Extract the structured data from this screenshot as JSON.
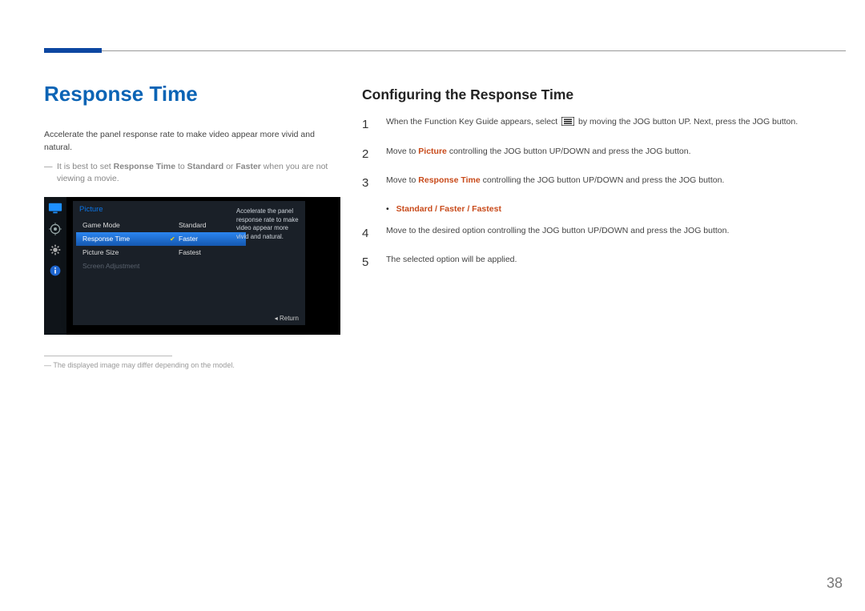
{
  "pageNumber": "38",
  "left": {
    "heading": "Response Time",
    "intro": "Accelerate the panel response rate to make video appear more vivid and natural.",
    "note_prefix": "It is best to set ",
    "note_b1": "Response Time",
    "note_mid1": " to ",
    "note_b2": "Standard",
    "note_mid2": " or ",
    "note_b3": "Faster",
    "note_suffix": " when you are not viewing a movie.",
    "footnote": "The displayed image may differ depending on the model."
  },
  "osd": {
    "title": "Picture",
    "menu": [
      "Game Mode",
      "Response Time",
      "Picture Size",
      "Screen Adjustment"
    ],
    "sub": [
      "Standard",
      "Faster",
      "Fastest"
    ],
    "help": "Accelerate the panel response rate to make video appear more vivid and natural.",
    "return": "Return"
  },
  "right": {
    "heading": "Configuring the Response Time",
    "steps": {
      "s1a": "When the Function Key Guide appears, select ",
      "s1b": " by moving the JOG button UP. Next, press the JOG button.",
      "s2a": "Move to ",
      "s2hl": "Picture",
      "s2b": " controlling the JOG button UP/DOWN and press the JOG button.",
      "s3a": "Move to ",
      "s3hl": "Response Time",
      "s3b": " controlling the JOG button UP/DOWN and press the JOG button.",
      "options": [
        "Standard",
        "Faster",
        "Fastest"
      ],
      "s4": "Move to the desired option controlling the JOG button UP/DOWN and press the JOG button.",
      "s5": "The selected option will be applied."
    },
    "nums": [
      "1",
      "2",
      "3",
      "4",
      "5"
    ]
  }
}
